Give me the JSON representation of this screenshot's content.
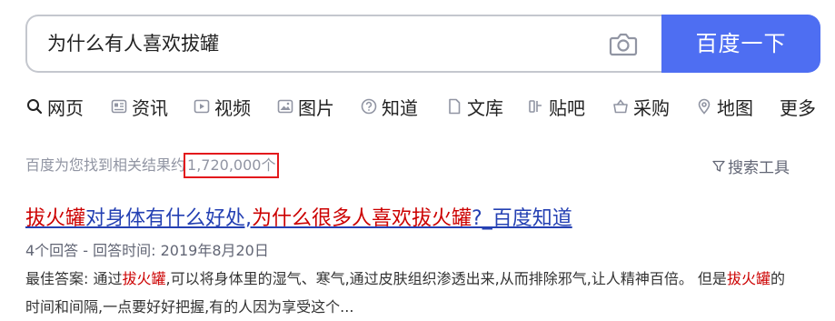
{
  "search": {
    "query": "为什么有人喜欢拔罐",
    "button_label": "百度一下"
  },
  "tabs": [
    {
      "label": "网页",
      "icon": "search-icon",
      "active": true
    },
    {
      "label": "资讯",
      "icon": "news-icon"
    },
    {
      "label": "视频",
      "icon": "video-icon"
    },
    {
      "label": "图片",
      "icon": "image-icon"
    },
    {
      "label": "知道",
      "icon": "question-icon"
    },
    {
      "label": "文库",
      "icon": "document-icon"
    },
    {
      "label": "贴吧",
      "icon": "tieba-icon"
    },
    {
      "label": "采购",
      "icon": "basket-icon"
    },
    {
      "label": "地图",
      "icon": "map-pin-icon"
    },
    {
      "label": "更多",
      "icon": ""
    }
  ],
  "results_summary": {
    "prefix": "百度为您找到相关结果约",
    "count": "1,720,000个",
    "tools_label": "搜索工具"
  },
  "result": {
    "title_em1": "拔火罐",
    "title_part2": "对身体有什么好处,",
    "title_em2": "为什么很多人喜欢拔火罐",
    "title_part4": "?_百度知道",
    "meta": "4个回答 - 回答时间: 2019年8月20日",
    "abstract_p1": "最佳答案: 通过",
    "abstract_em1": "拔火罐",
    "abstract_p2": ",可以将身体里的湿气、寒气,通过皮肤组织渗透出来,从而排除邪气,让人精神百倍。 但是",
    "abstract_em2": "拔火罐",
    "abstract_p3": "的时间和间隔,一点要好好把握,有的人因为享受这个..."
  },
  "colors": {
    "accent": "#4e6ef2",
    "link": "#2440b3",
    "highlight": "#cc0000",
    "annotation_box": "#e3191c"
  }
}
